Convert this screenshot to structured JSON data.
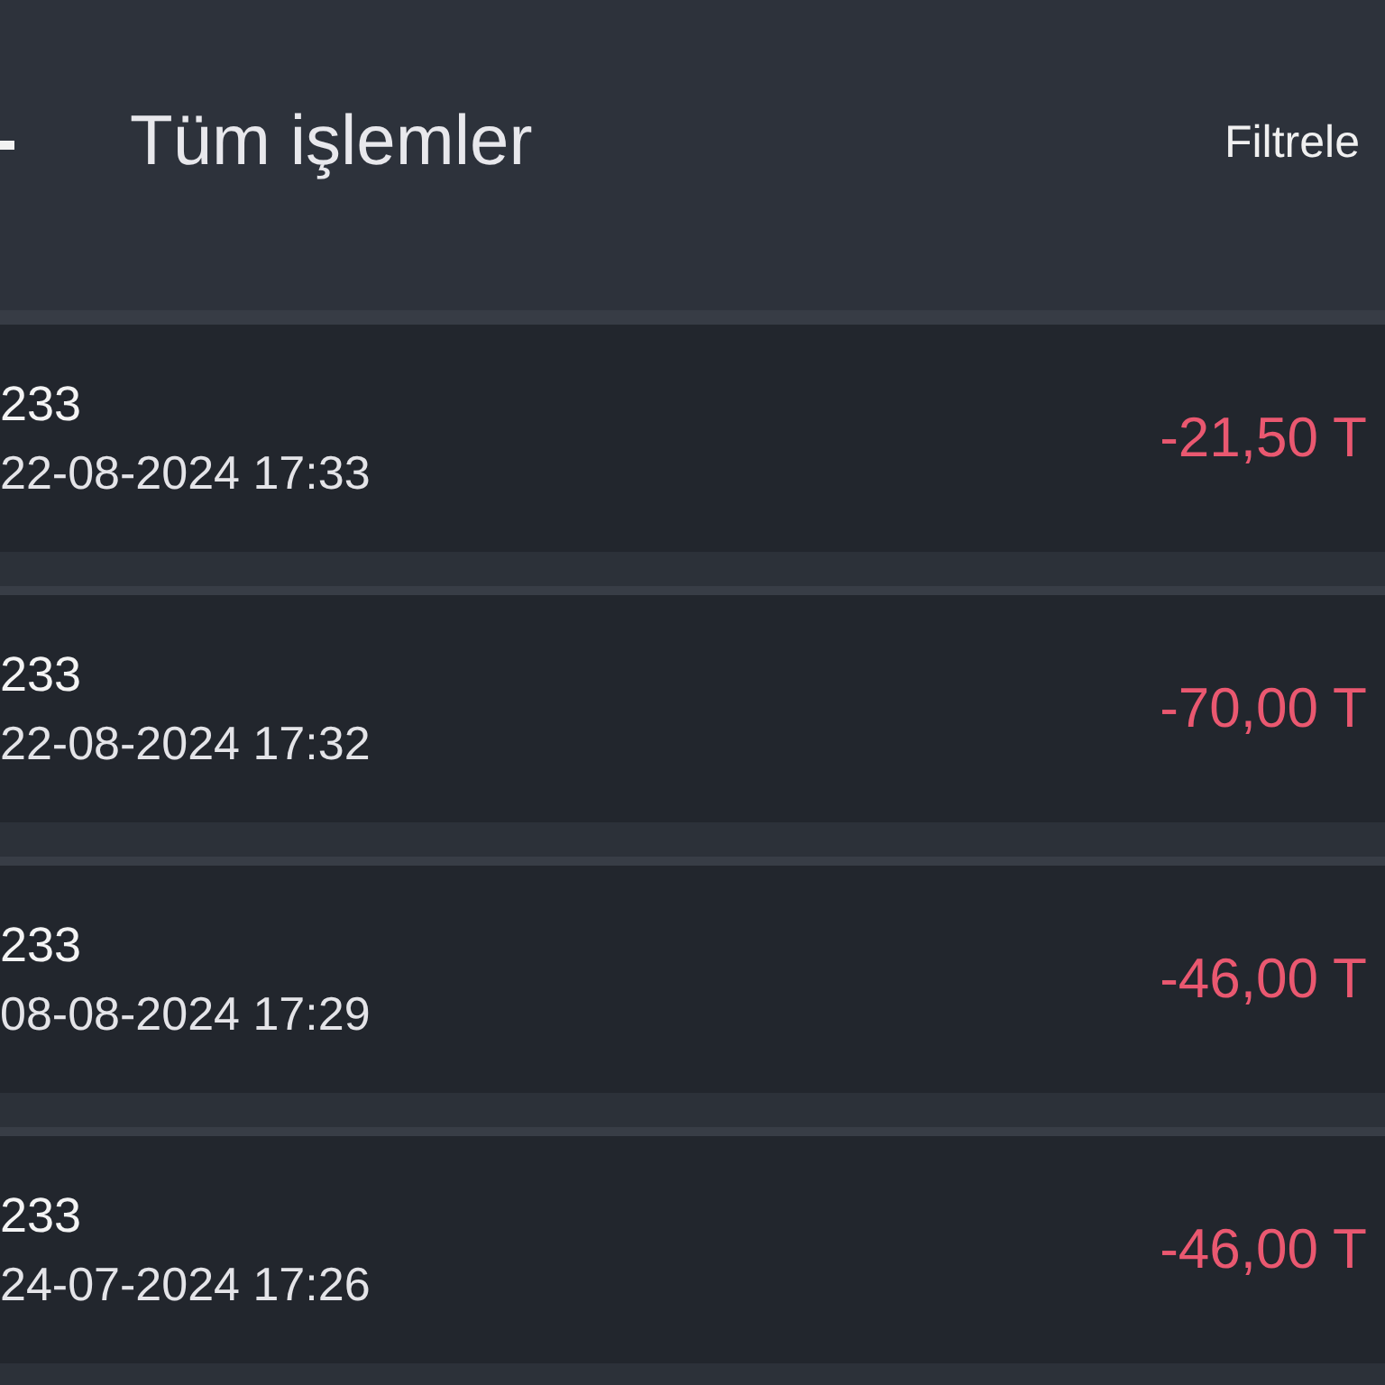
{
  "header": {
    "title": "Tüm işlemler",
    "filter_label": "Filtrele"
  },
  "transactions": [
    {
      "reference": "233",
      "date": "22-08-2024 17:33",
      "amount": "-21,50 T"
    },
    {
      "reference": "233",
      "date": "22-08-2024 17:32",
      "amount": "-70,00 T"
    },
    {
      "reference": "233",
      "date": "08-08-2024 17:29",
      "amount": "-46,00 T"
    },
    {
      "reference": "233",
      "date": "24-07-2024 17:26",
      "amount": "-46,00 T"
    }
  ]
}
